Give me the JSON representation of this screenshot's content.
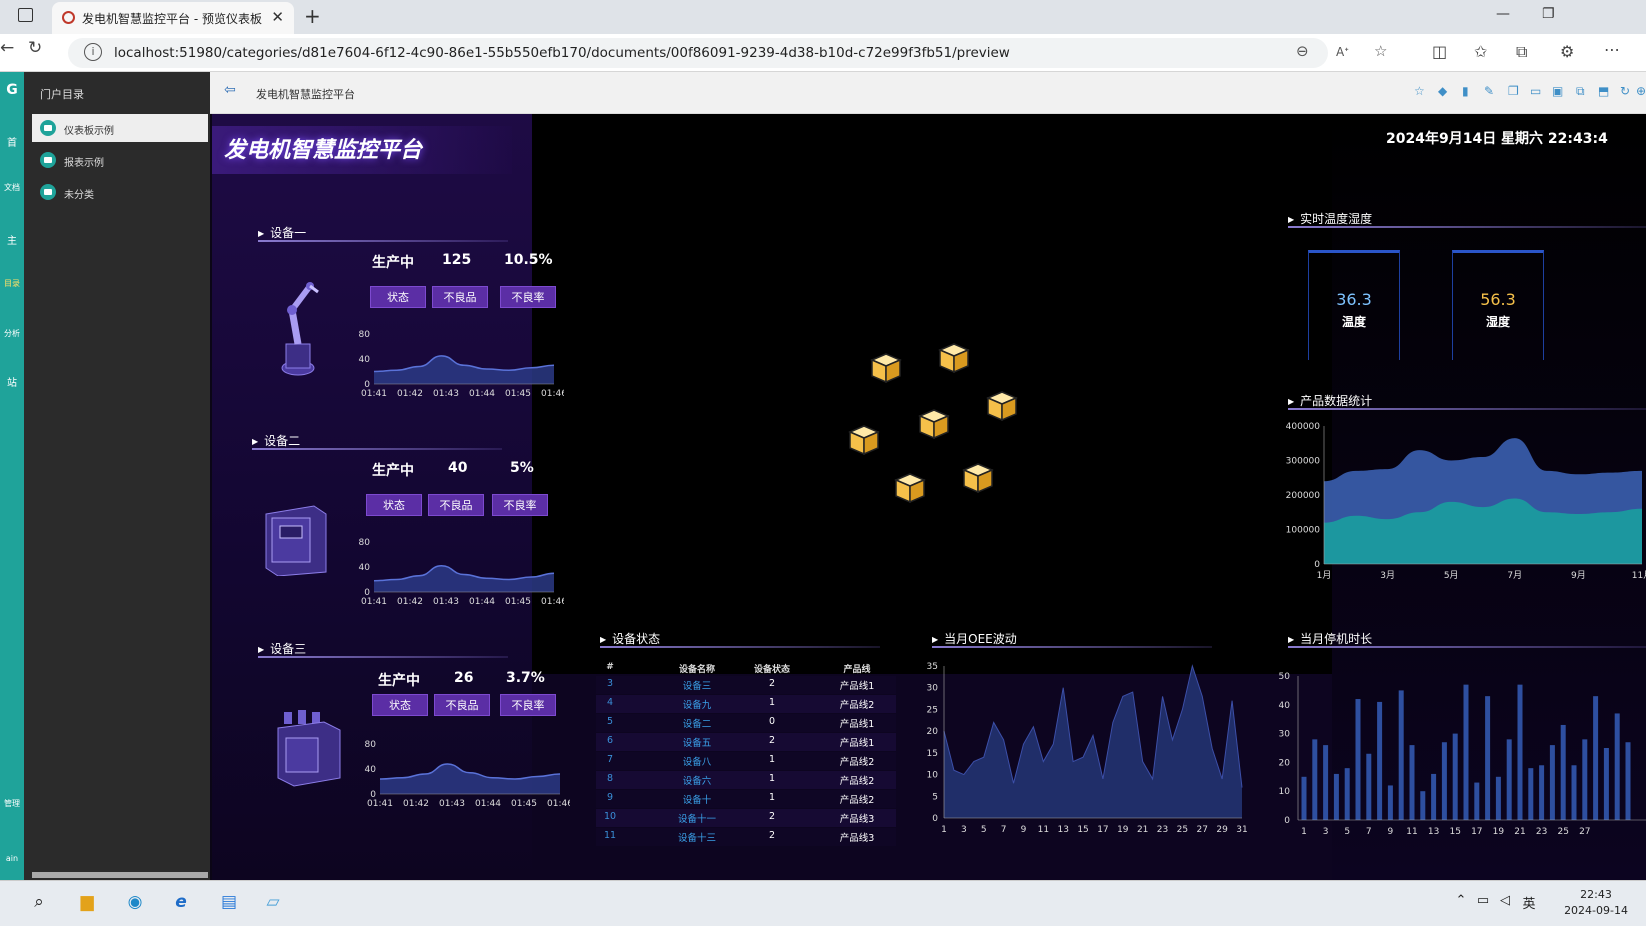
{
  "browser": {
    "tab_title": "发电机智慧监控平台 - 预览仪表板",
    "url": "localhost:51980/categories/d81e7604-6f12-4c90-86e1-55b550efb170/documents/00f86091-9239-4d38-b10d-c72e99f3fb51/preview"
  },
  "portal": {
    "sidebar_title": "门户目录",
    "items": [
      {
        "label": "仪表板示例",
        "active": true
      },
      {
        "label": "报表示例",
        "active": false
      },
      {
        "label": "未分类",
        "active": false
      }
    ],
    "rail_labels": [
      "首",
      "文档",
      "主",
      "目录",
      "分析",
      "站",
      "管理",
      "ain"
    ],
    "breadcrumb": "发电机智慧监控平台"
  },
  "dashboard": {
    "title": "发电机智慧监控平台",
    "datetime": "2024年9月14日 星期六  22:43:4",
    "devices": [
      {
        "name": "设备一",
        "status": "生产中",
        "defects": "125",
        "rate": "10.5%",
        "buttons": [
          "状态",
          "不良品",
          "不良率"
        ],
        "times": [
          "01:41",
          "01:42",
          "01:43",
          "01:44",
          "01:45",
          "01:46"
        ],
        "y_ticks": [
          "80",
          "40",
          "0"
        ],
        "values": [
          20,
          22,
          28,
          45,
          30,
          24,
          22,
          26,
          30
        ]
      },
      {
        "name": "设备二",
        "status": "生产中",
        "defects": "40",
        "rate": "5%",
        "buttons": [
          "状态",
          "不良品",
          "不良率"
        ],
        "times": [
          "01:41",
          "01:42",
          "01:43",
          "01:44",
          "01:45",
          "01:46"
        ],
        "y_ticks": [
          "80",
          "40",
          "0"
        ],
        "values": [
          18,
          20,
          26,
          42,
          28,
          22,
          20,
          24,
          30
        ]
      },
      {
        "name": "设备三",
        "status": "生产中",
        "defects": "26",
        "rate": "3.7%",
        "buttons": [
          "状态",
          "不良品",
          "不良率"
        ],
        "times": [
          "01:41",
          "01:42",
          "01:43",
          "01:44",
          "01:45",
          "01:46"
        ],
        "y_ticks": [
          "80",
          "40",
          "0"
        ],
        "values": [
          24,
          26,
          32,
          48,
          34,
          26,
          24,
          28,
          32
        ]
      }
    ],
    "env": {
      "heading": "实时温度湿度",
      "temperature": {
        "value": "36.3",
        "label": "温度",
        "color": "#7ec3ff"
      },
      "humidity": {
        "value": "56.3",
        "label": "湿度",
        "color": "#f5c04a"
      }
    },
    "product_stats": {
      "heading": "产品数据统计"
    },
    "device_status": {
      "heading": "设备状态",
      "columns": [
        "#",
        "设备名称",
        "设备状态",
        "产品线"
      ],
      "rows": [
        [
          "3",
          "设备三",
          "2",
          "产品线1"
        ],
        [
          "4",
          "设备九",
          "1",
          "产品线2"
        ],
        [
          "5",
          "设备二",
          "0",
          "产品线1"
        ],
        [
          "6",
          "设备五",
          "2",
          "产品线1"
        ],
        [
          "7",
          "设备八",
          "1",
          "产品线2"
        ],
        [
          "8",
          "设备六",
          "1",
          "产品线2"
        ],
        [
          "9",
          "设备十",
          "1",
          "产品线2"
        ],
        [
          "10",
          "设备十一",
          "2",
          "产品线3"
        ],
        [
          "11",
          "设备十三",
          "2",
          "产品线3"
        ]
      ]
    },
    "oee": {
      "heading": "当月OEE波动"
    },
    "downtime": {
      "heading": "当月停机时长"
    }
  },
  "chart_data": [
    {
      "type": "area",
      "categories": [
        "1月",
        "2月",
        "3月",
        "4月",
        "5月",
        "6月",
        "7月",
        "8月",
        "9月",
        "10月",
        "11月"
      ],
      "x_tick_labels": [
        "1月",
        "3月",
        "5月",
        "7月",
        "9月",
        "11月"
      ],
      "ylim": [
        0,
        400000
      ],
      "y_ticks": [
        "400000",
        "300000",
        "200000",
        "100000",
        "0"
      ],
      "series": [
        {
          "values": [
            240000,
            270000,
            275000,
            330000,
            300000,
            310000,
            365000,
            270000,
            260000,
            265000,
            270000
          ],
          "color": "#3b5fb0"
        },
        {
          "values": [
            120000,
            140000,
            130000,
            150000,
            180000,
            165000,
            190000,
            150000,
            145000,
            150000,
            160000
          ],
          "color": "#1a9e9e"
        }
      ]
    },
    {
      "type": "area",
      "x_tick_labels": [
        "1",
        "3",
        "5",
        "7",
        "9",
        "11",
        "13",
        "15",
        "17",
        "19",
        "21",
        "23",
        "25",
        "27",
        "29",
        "31"
      ],
      "ylim": [
        0,
        35
      ],
      "y_ticks": [
        "35",
        "30",
        "25",
        "20",
        "15",
        "10",
        "5",
        "0"
      ],
      "values": [
        20,
        11,
        10,
        13,
        14,
        22,
        18,
        8,
        17,
        21,
        13,
        17,
        30,
        13,
        14,
        19,
        9,
        22,
        28,
        29,
        13,
        9,
        28,
        18,
        25,
        37,
        28,
        16,
        9,
        27,
        7
      ]
    },
    {
      "type": "bar",
      "x_tick_labels": [
        "1",
        "3",
        "5",
        "7",
        "9",
        "11",
        "13",
        "15",
        "17",
        "19",
        "21",
        "23",
        "25",
        "27"
      ],
      "ylim": [
        0,
        50
      ],
      "y_ticks": [
        "50",
        "40",
        "30",
        "20",
        "10",
        "0"
      ],
      "values": [
        15,
        28,
        26,
        16,
        18,
        42,
        23,
        41,
        12,
        45,
        26,
        10,
        16,
        27,
        30,
        47,
        13,
        43,
        15,
        28,
        47,
        18,
        19,
        26,
        33,
        19,
        28,
        43,
        25,
        37,
        27
      ]
    }
  ]
}
